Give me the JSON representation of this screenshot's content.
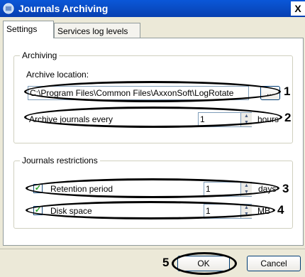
{
  "window": {
    "title": "Journals Archiving",
    "close_label": "X"
  },
  "tabs": [
    {
      "label": "Settings",
      "active": true
    },
    {
      "label": "Services log levels",
      "active": false
    }
  ],
  "archiving": {
    "group_label": "Archiving",
    "location_label": "Archive location:",
    "location_value": "C:\\Program Files\\Common Files\\AxxonSoft\\LogRotate",
    "browse_label": "...",
    "every_label": "Archive journals every",
    "every_value": "1",
    "every_unit": "hours"
  },
  "restrictions": {
    "group_label": "Journals restrictions",
    "retention": {
      "label": "Retention period",
      "checked": true,
      "value": "1",
      "unit": "days"
    },
    "disk": {
      "label": "Disk space",
      "checked": true,
      "value": "1",
      "unit": "MB"
    }
  },
  "buttons": {
    "ok": "OK",
    "cancel": "Cancel"
  },
  "callouts": [
    "1",
    "2",
    "3",
    "4",
    "5"
  ],
  "colors": {
    "title_bar": "#0a57d8",
    "check": "#21a121"
  }
}
